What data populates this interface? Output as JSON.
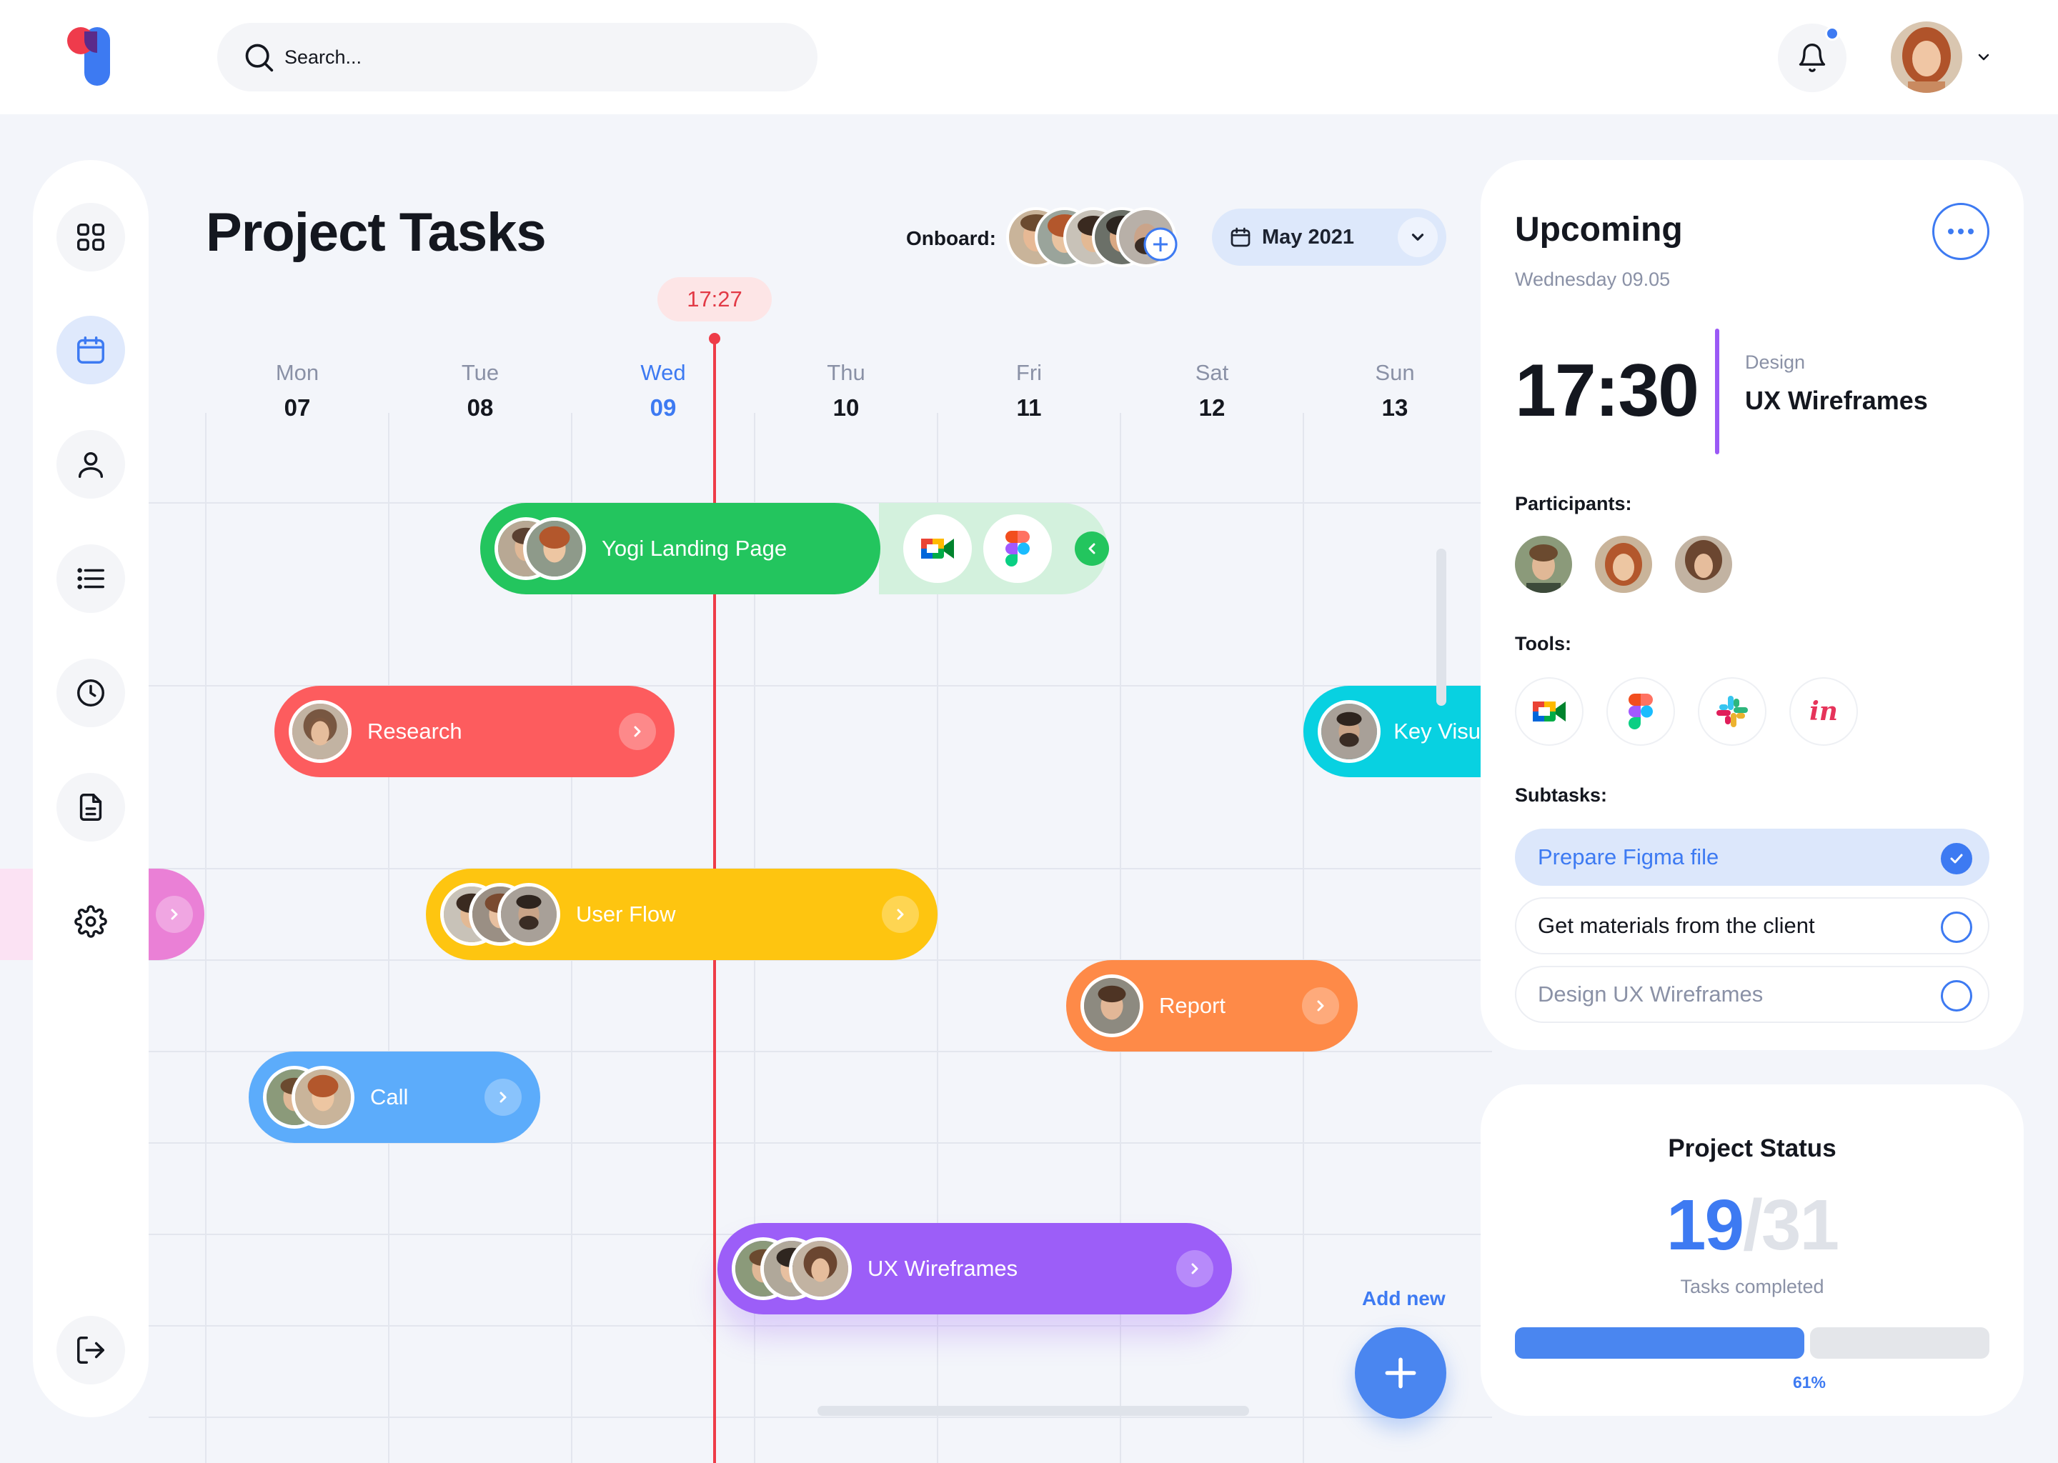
{
  "topbar": {
    "search_placeholder": "Search...",
    "notifications_unread": true
  },
  "sidebar": {
    "items": [
      {
        "name": "dashboard",
        "icon": "grid-icon"
      },
      {
        "name": "calendar",
        "icon": "calendar-icon",
        "active": true
      },
      {
        "name": "profile",
        "icon": "user-icon"
      },
      {
        "name": "list",
        "icon": "list-icon"
      },
      {
        "name": "history",
        "icon": "clock-icon"
      },
      {
        "name": "documents",
        "icon": "document-icon"
      },
      {
        "name": "settings",
        "icon": "gear-icon"
      },
      {
        "name": "logout",
        "icon": "logout-icon"
      }
    ]
  },
  "header": {
    "title": "Project Tasks",
    "onboard_label": "Onboard:",
    "month": "May 2021"
  },
  "timeline": {
    "current_time": "17:27",
    "days": [
      {
        "name": "Mon",
        "date": "07"
      },
      {
        "name": "Tue",
        "date": "08"
      },
      {
        "name": "Wed",
        "date": "09",
        "today": true
      },
      {
        "name": "Thu",
        "date": "10"
      },
      {
        "name": "Fri",
        "date": "11"
      },
      {
        "name": "Sat",
        "date": "12"
      },
      {
        "name": "Sun",
        "date": "13"
      }
    ],
    "tasks": {
      "yogi": {
        "label": "Yogi Landing Page",
        "color": "#23c55e",
        "tools": [
          "google-meet-icon",
          "figma-icon"
        ]
      },
      "research": {
        "label": "Research",
        "color": "#fd5c5e"
      },
      "key_visual": {
        "label": "Key Visu",
        "color": "#08d1e1"
      },
      "user_flow": {
        "label": "User Flow",
        "color": "#fec510"
      },
      "report": {
        "label": "Report",
        "color": "#fe8a48"
      },
      "call": {
        "label": "Call",
        "color": "#5cacfb"
      },
      "ux_wireframes": {
        "label": "UX Wireframes",
        "color": "#9c5ef8"
      }
    },
    "add_new": "Add new"
  },
  "upcoming": {
    "title": "Upcoming",
    "date": "Wednesday 09.05",
    "time": "17:30",
    "category": "Design",
    "event": "UX Wireframes",
    "participants_label": "Participants:",
    "tools_label": "Tools:",
    "tools": [
      "google-meet-icon",
      "figma-icon",
      "slack-icon",
      "invision-icon"
    ],
    "subtasks_label": "Subtasks:",
    "subtasks": [
      {
        "label": "Prepare Figma file",
        "done": true
      },
      {
        "label": "Get materials from the client",
        "done": false
      },
      {
        "label": "Design UX Wireframes",
        "done": false
      }
    ]
  },
  "project_status": {
    "title": "Project Status",
    "completed": "19",
    "total": "/31",
    "subtitle": "Tasks completed",
    "progress_percent": 61,
    "progress_label": "61%"
  },
  "colors": {
    "accent": "#3d7af2",
    "now_line": "#ee3c48"
  }
}
